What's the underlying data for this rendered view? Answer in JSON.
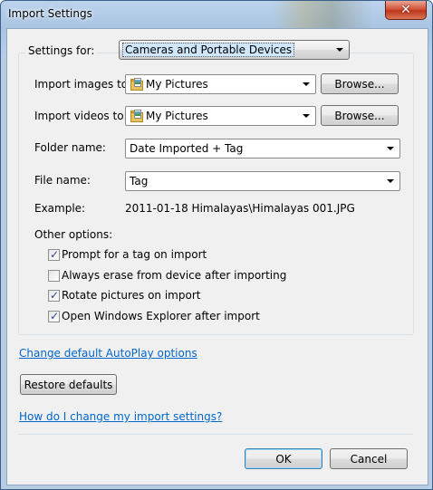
{
  "window": {
    "title": "Import Settings",
    "close_glyph": "✕"
  },
  "settings_for": {
    "label": "Settings for:",
    "value": "Cameras and Portable Devices"
  },
  "import_images": {
    "label": "Import images to:",
    "value": "My Pictures",
    "browse_label": "Browse..."
  },
  "import_videos": {
    "label": "Import videos to:",
    "value": "My Pictures",
    "browse_label": "Browse..."
  },
  "folder_name": {
    "label": "Folder name:",
    "value": "Date Imported + Tag"
  },
  "file_name": {
    "label": "File name:",
    "value": "Tag"
  },
  "example": {
    "label": "Example:",
    "value": "2011-01-18 Himalayas\\Himalayas 001.JPG"
  },
  "other_options": {
    "label": "Other options:",
    "items": [
      {
        "label": "Prompt for a tag on import",
        "checked": true
      },
      {
        "label": "Always erase from device after importing",
        "checked": false
      },
      {
        "label": "Rotate pictures on import",
        "checked": true
      },
      {
        "label": "Open Windows Explorer after import",
        "checked": true
      }
    ]
  },
  "links": {
    "autoplay": "Change default AutoPlay options",
    "help": "How do I change my import settings?"
  },
  "buttons": {
    "restore": "Restore defaults",
    "ok": "OK",
    "cancel": "Cancel"
  },
  "icons": {
    "folder": "folder-pictures-icon",
    "dropdown": "chevron-down-icon",
    "close": "close-icon",
    "check": "checkmark-icon"
  },
  "colors": {
    "link": "#0066cc",
    "titlebar": "#a9c4e2",
    "close": "#c1361c",
    "dialog_bg": "#f0f0f0"
  }
}
